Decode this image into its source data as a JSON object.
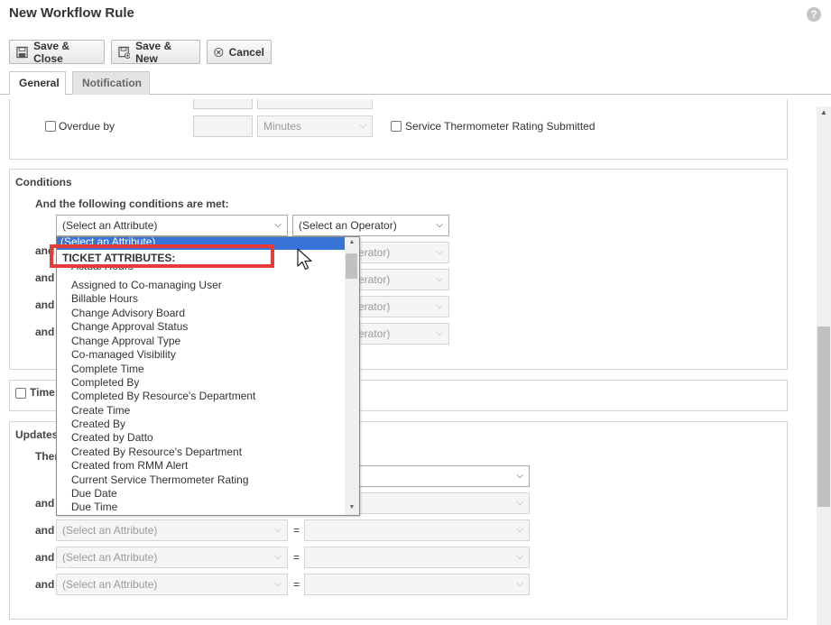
{
  "header": {
    "title": "New Workflow Rule",
    "help_icon": "?"
  },
  "toolbar": {
    "save_close": "Save & Close",
    "save_new": "Save & New",
    "cancel": "Cancel"
  },
  "tabs": [
    {
      "label": "General"
    },
    {
      "label": "Notification"
    }
  ],
  "events": {
    "overdue_label": "Overdue by",
    "overdue_unit": "Minutes",
    "thermometer_label": "Service Thermometer Rating Submitted"
  },
  "conditions": {
    "title": "Conditions",
    "subtitle": "And the following conditions are met:",
    "attribute_placeholder": "(Select an Attribute)",
    "operator_placeholder": "(Select an Operator)",
    "and_label": "and",
    "operator_partial": "erator)"
  },
  "dropdown": {
    "selected": "(Select an Attribute)",
    "group": "TICKET ATTRIBUTES:",
    "items": [
      "Actual Hours",
      "Assigned to Co-managing User",
      "Billable Hours",
      "Change Advisory Board",
      "Change Approval Status",
      "Change Approval Type",
      "Co-managed Visibility",
      "Complete Time",
      "Completed By",
      "Completed By Resource's Department",
      "Create Time",
      "Created By",
      "Created by Datto",
      "Created By Resource's Department",
      "Created from RMM Alert",
      "Current Service Thermometer Rating",
      "Due Date",
      "Due Time"
    ]
  },
  "time": {
    "label": "Time"
  },
  "updates": {
    "title": "Updates",
    "then_label": "Ther",
    "and_label": "and",
    "attribute_placeholder": "(Select an Attribute)",
    "equals": "="
  }
}
